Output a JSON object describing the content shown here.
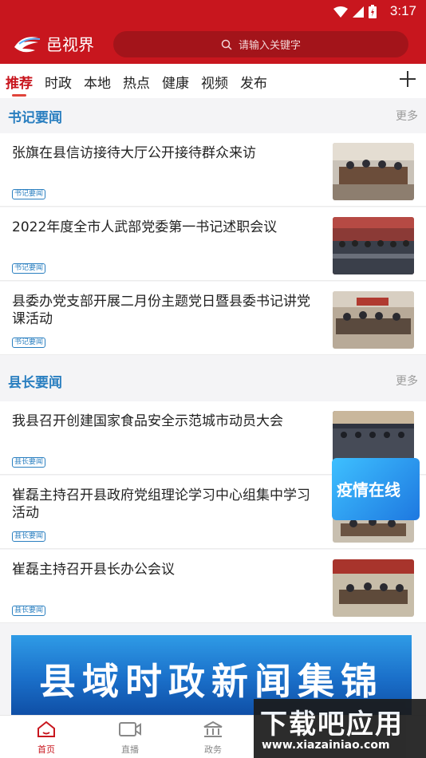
{
  "status_bar": {
    "time": "3:17"
  },
  "header": {
    "app_name": "邑视界",
    "search_placeholder": "请输入关键字"
  },
  "tabs": [
    {
      "label": "推荐",
      "active": true
    },
    {
      "label": "时政"
    },
    {
      "label": "本地"
    },
    {
      "label": "热点"
    },
    {
      "label": "健康"
    },
    {
      "label": "视频"
    },
    {
      "label": "发布"
    }
  ],
  "sections": [
    {
      "title": "书记要闻",
      "more": "更多",
      "items": [
        {
          "headline": "张旗在县信访接待大厅公开接待群众来访",
          "tag": "书记要闻"
        },
        {
          "headline": "2022年度全市人武部党委第一书记述职会议",
          "tag": "书记要闻"
        },
        {
          "headline": "县委办党支部开展二月份主题党日暨县委书记讲党课活动",
          "tag": "书记要闻"
        }
      ]
    },
    {
      "title": "县长要闻",
      "more": "更多",
      "items": [
        {
          "headline": "我县召开创建国家食品安全示范城市动员大会",
          "tag": "县长要闻"
        },
        {
          "headline": "崔磊主持召开县政府党组理论学习中心组集中学习活动",
          "tag": "县长要闻"
        },
        {
          "headline": "崔磊主持召开县长办公会议",
          "tag": "县长要闻"
        }
      ]
    }
  ],
  "banner": {
    "text": "县域时政新闻集锦"
  },
  "float_badge": {
    "text": "疫情在线"
  },
  "bottom_nav": [
    {
      "label": "首页",
      "active": true
    },
    {
      "label": "直播"
    },
    {
      "label": "政务"
    }
  ],
  "watermark": {
    "line1": "下载吧应用",
    "line2": "www.xiazainiao.com"
  },
  "colors": {
    "brand_red": "#c8161e",
    "section_blue": "#2a7fc0"
  }
}
